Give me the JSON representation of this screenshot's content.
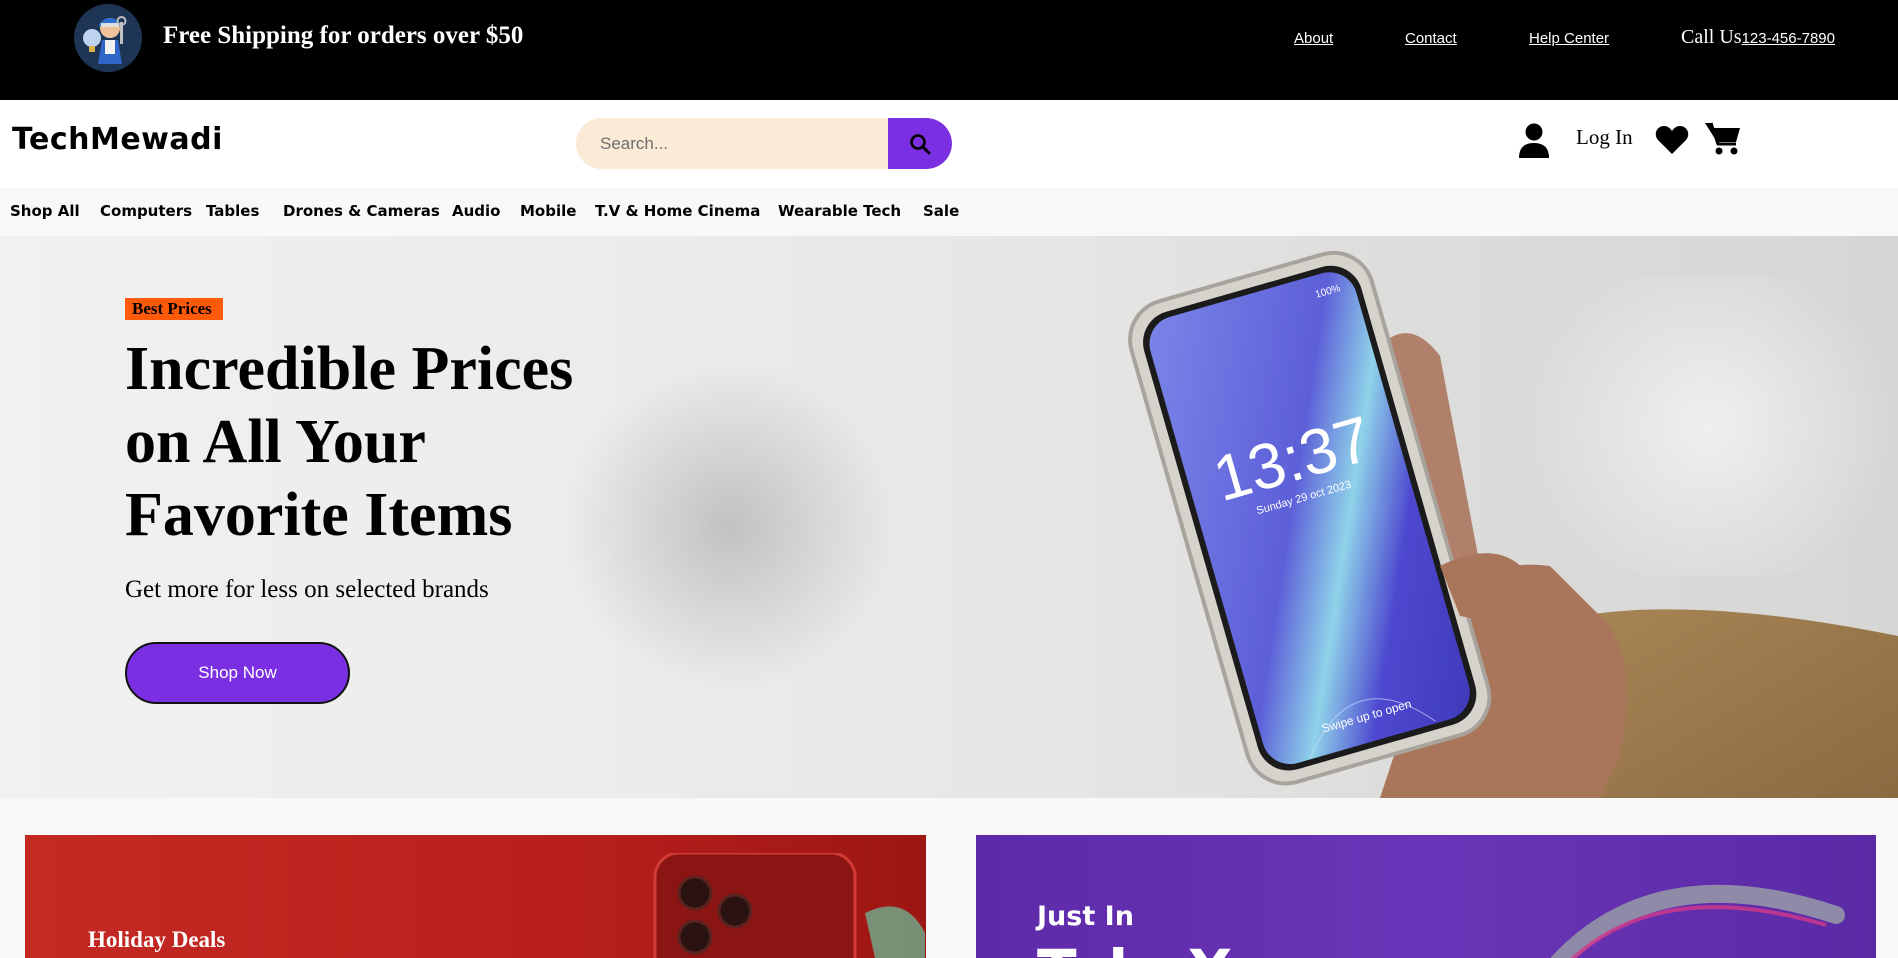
{
  "topbar": {
    "promo": "Free Shipping for orders over $50",
    "links": [
      "About",
      "Contact",
      "Help Center"
    ],
    "call_label": "Call Us",
    "phone": "123-456-7890"
  },
  "header": {
    "brand": "TechMewadi",
    "search_placeholder": "Search...",
    "login": "Log In"
  },
  "nav": {
    "items": [
      "Shop All",
      "Computers",
      "Tables",
      "Drones & Cameras",
      "Audio",
      "Mobile",
      "T.V & Home Cinema",
      "Wearable Tech",
      "Sale"
    ]
  },
  "hero": {
    "badge": "Best Prices",
    "title": "Incredible Prices on All Your Favorite Items",
    "subtitle": "Get more for less on selected brands",
    "cta": "Shop Now",
    "phone_time": "13:37",
    "phone_date": "Sunday 29 oct 2023",
    "phone_battery": "100%",
    "phone_swipe": "Swipe up to open"
  },
  "cards": {
    "left_label": "Holiday Deals",
    "right_label": "Just In",
    "right_big": "Tele X..."
  },
  "colors": {
    "accent": "#7b2fe3",
    "badge": "#ff5a0a",
    "topbar": "#000000",
    "search_bg": "#fbead6"
  }
}
